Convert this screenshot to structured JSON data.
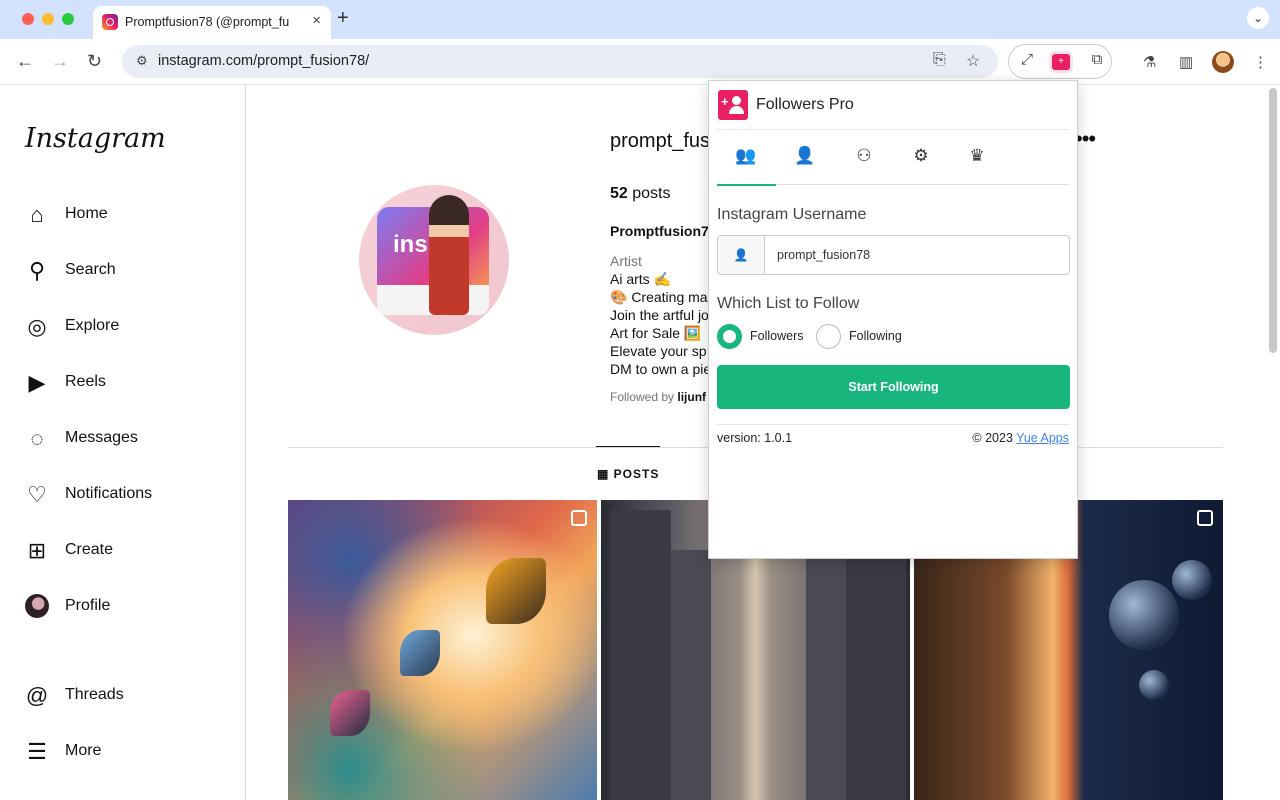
{
  "browser": {
    "tab_title": "Promptfusion78 (@prompt_fu",
    "url": "instagram.com/prompt_fusion78/",
    "tab_close": "×",
    "new_tab": "+"
  },
  "sidebar": {
    "logo": "Instagram",
    "items": [
      {
        "label": "Home",
        "icon": "home-icon",
        "glyph": "⌂"
      },
      {
        "label": "Search",
        "icon": "search-icon",
        "glyph": "⚲"
      },
      {
        "label": "Explore",
        "icon": "compass-icon",
        "glyph": "◎"
      },
      {
        "label": "Reels",
        "icon": "reels-icon",
        "glyph": "▶"
      },
      {
        "label": "Messages",
        "icon": "messenger-icon",
        "glyph": "◌"
      },
      {
        "label": "Notifications",
        "icon": "heart-icon",
        "glyph": "♡"
      },
      {
        "label": "Create",
        "icon": "plus-square-icon",
        "glyph": "⊞"
      },
      {
        "label": "Profile",
        "icon": "avatar",
        "glyph": ""
      },
      {
        "label": "Threads",
        "icon": "threads-icon",
        "glyph": "@"
      },
      {
        "label": "More",
        "icon": "menu-icon",
        "glyph": "☰"
      }
    ]
  },
  "profile": {
    "username": "prompt_fus",
    "posts_number": "52",
    "posts_word": " posts",
    "full_name": "Promptfusion7",
    "category": "Artist",
    "bio": [
      "Ai arts ✍️",
      "🎨 Creating ma",
      "Join the artful jo",
      "Art for Sale 🖼️",
      "Elevate your sp",
      "DM to own a pie"
    ],
    "followed_by_prefix": "Followed by ",
    "followed_by_name": "lijunf",
    "pic_text": "ins",
    "posts_tab": "POSTS"
  },
  "popup": {
    "title": "Followers Pro",
    "tabs": [
      {
        "name": "followers-tab-icon",
        "glyph": "👥",
        "active": true
      },
      {
        "name": "following-tab-icon",
        "glyph": "👤",
        "active": false
      },
      {
        "name": "group-tab-icon",
        "glyph": "⚇",
        "active": false
      },
      {
        "name": "settings-gear-icon",
        "glyph": "⚙",
        "active": false
      },
      {
        "name": "crown-icon",
        "glyph": "♛",
        "active": false
      }
    ],
    "username_label": "Instagram Username",
    "username_value": "prompt_fusion78",
    "list_label": "Which List to Follow",
    "options": [
      "Followers",
      "Following"
    ],
    "selected_option": "Followers",
    "button_label": "Start Following",
    "version": "version: 1.0.1",
    "copyright_prefix": "© 2023 ",
    "copyright_link": "Yue Apps"
  },
  "colors": {
    "accent_green": "#18b67c",
    "brand_pink": "#e91e63",
    "link_blue": "#3b82f6"
  }
}
